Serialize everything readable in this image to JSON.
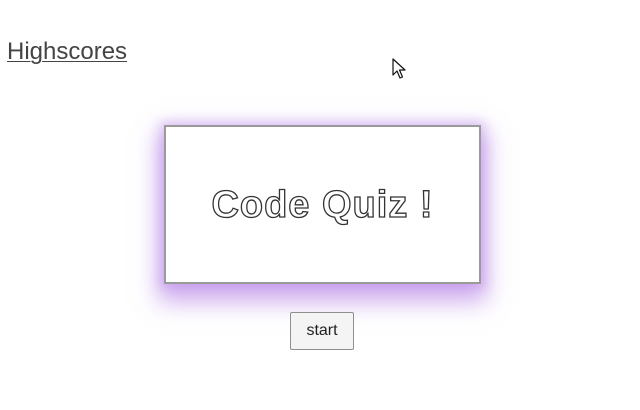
{
  "nav": {
    "highscores_label": "Highscores"
  },
  "quiz": {
    "title": "Code Quiz !",
    "start_label": "start"
  },
  "colors": {
    "glow": "#b06ee1",
    "card_border": "#9a9a9a"
  },
  "icons": {
    "cursor": "mouse-pointer-icon"
  }
}
